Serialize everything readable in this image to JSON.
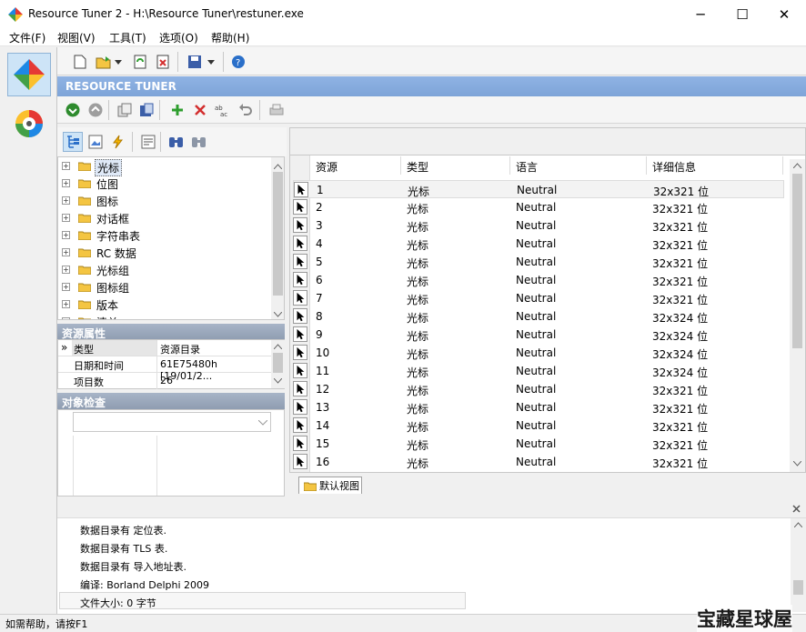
{
  "window": {
    "title": "Resource Tuner 2 - H:\\Resource Tuner\\restuner.exe",
    "minimize": "─",
    "maximize": "☐",
    "close": "✕"
  },
  "menu": [
    "文件(F)",
    "视图(V)",
    "工具(T)",
    "选项(O)",
    "帮助(H)"
  ],
  "banner": "RESOURCE TUNER",
  "tree": {
    "items": [
      "光标",
      "位图",
      "图标",
      "对话框",
      "字符串表",
      "RC 数据",
      "光标组",
      "图标组",
      "版本",
      "清单"
    ],
    "selected_index": 0,
    "expand_symbol": "+"
  },
  "props": {
    "section_title": "资源属性",
    "rows": [
      {
        "name": "类型",
        "value": "资源目录"
      },
      {
        "name": "日期和时间",
        "value": "61E75480h  [19/01/2..."
      },
      {
        "name": "项目数",
        "value": "26"
      }
    ],
    "marker": "»"
  },
  "inspect": {
    "section_title": "对象检查"
  },
  "table": {
    "headers": [
      "资源",
      "类型",
      "语言",
      "详细信息"
    ],
    "rows": [
      {
        "id": "1",
        "type": "光标",
        "lang": "Neutral",
        "info": "32x321 位"
      },
      {
        "id": "2",
        "type": "光标",
        "lang": "Neutral",
        "info": "32x321 位"
      },
      {
        "id": "3",
        "type": "光标",
        "lang": "Neutral",
        "info": "32x321 位"
      },
      {
        "id": "4",
        "type": "光标",
        "lang": "Neutral",
        "info": "32x321 位"
      },
      {
        "id": "5",
        "type": "光标",
        "lang": "Neutral",
        "info": "32x321 位"
      },
      {
        "id": "6",
        "type": "光标",
        "lang": "Neutral",
        "info": "32x321 位"
      },
      {
        "id": "7",
        "type": "光标",
        "lang": "Neutral",
        "info": "32x321 位"
      },
      {
        "id": "8",
        "type": "光标",
        "lang": "Neutral",
        "info": "32x324 位"
      },
      {
        "id": "9",
        "type": "光标",
        "lang": "Neutral",
        "info": "32x324 位"
      },
      {
        "id": "10",
        "type": "光标",
        "lang": "Neutral",
        "info": "32x324 位"
      },
      {
        "id": "11",
        "type": "光标",
        "lang": "Neutral",
        "info": "32x324 位"
      },
      {
        "id": "12",
        "type": "光标",
        "lang": "Neutral",
        "info": "32x321 位"
      },
      {
        "id": "13",
        "type": "光标",
        "lang": "Neutral",
        "info": "32x321 位"
      },
      {
        "id": "14",
        "type": "光标",
        "lang": "Neutral",
        "info": "32x321 位"
      },
      {
        "id": "15",
        "type": "光标",
        "lang": "Neutral",
        "info": "32x321 位"
      },
      {
        "id": "16",
        "type": "光标",
        "lang": "Neutral",
        "info": "32x321 位"
      }
    ]
  },
  "tab_label": "默认视图",
  "log": {
    "lines": [
      "数据目录有 定位表.",
      "数据目录有 TLS 表.",
      "数据目录有 导入地址表.",
      "编译: Borland Delphi 2009",
      "文件大小: 0 字节"
    ]
  },
  "status": "如需帮助，请按F1",
  "watermark": "宝藏星球屋",
  "colors": {
    "banner": "#7ea4d8",
    "section": "#98a6ba",
    "selection": "#dfe9f7"
  }
}
